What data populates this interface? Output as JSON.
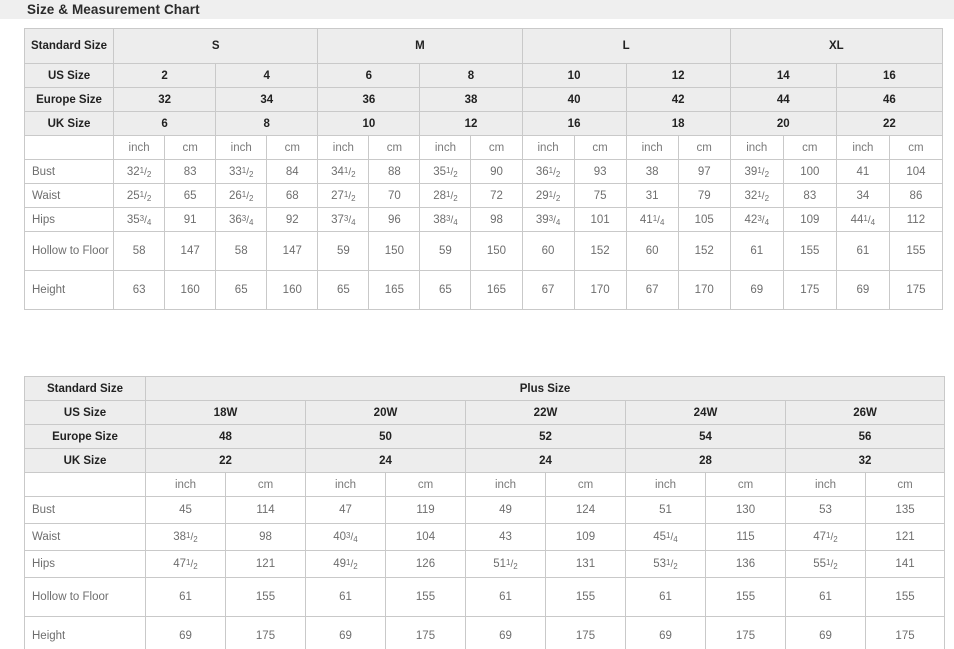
{
  "page": {
    "title": "Size & Measurement Chart",
    "title_band_color": "#efefef",
    "header_cell_color": "#ededed",
    "border_color": "#c9c9c9",
    "text_color": "#6e6e6e",
    "header_text_color": "#222222"
  },
  "table1": {
    "label_standard_size": "Standard Size",
    "label_us_size": "US Size",
    "label_europe_size": "Europe Size",
    "label_uk_size": "UK Size",
    "unit_inch": "inch",
    "unit_cm": "cm",
    "size_groups": [
      {
        "name": "S",
        "span": 4
      },
      {
        "name": "M",
        "span": 4
      },
      {
        "name": "L",
        "span": 4
      },
      {
        "name": "XL",
        "span": 4
      }
    ],
    "us_sizes": [
      "2",
      "4",
      "6",
      "8",
      "10",
      "12",
      "14",
      "16"
    ],
    "europe_sizes": [
      "32",
      "34",
      "36",
      "38",
      "40",
      "42",
      "44",
      "46"
    ],
    "uk_sizes": [
      "6",
      "8",
      "10",
      "12",
      "16",
      "18",
      "20",
      "22"
    ],
    "rows": [
      {
        "label": "Bust",
        "inch": [
          "32 1/2",
          "33 1/2",
          "34 1/2",
          "35 1/2",
          "36 1/2",
          "38",
          "39 1/2",
          "41"
        ],
        "cm": [
          "83",
          "84",
          "88",
          "90",
          "93",
          "97",
          "100",
          "104"
        ]
      },
      {
        "label": "Waist",
        "inch": [
          "25 1/2",
          "26 1/2",
          "27 1/2",
          "28 1/2",
          "29 1/2",
          "31",
          "32 1/2",
          "34"
        ],
        "cm": [
          "65",
          "68",
          "70",
          "72",
          "75",
          "79",
          "83",
          "86"
        ]
      },
      {
        "label": "Hips",
        "inch": [
          "35 3/4",
          "36 3/4",
          "37 3/4",
          "38 3/4",
          "39 3/4",
          "41 1/4",
          "42 3/4",
          "44 1/4"
        ],
        "cm": [
          "91",
          "92",
          "96",
          "98",
          "101",
          "105",
          "109",
          "112"
        ]
      },
      {
        "label": "Hollow to Floor",
        "inch": [
          "58",
          "58",
          "59",
          "59",
          "60",
          "60",
          "61",
          "61"
        ],
        "cm": [
          "147",
          "147",
          "150",
          "150",
          "152",
          "152",
          "155",
          "155"
        ]
      },
      {
        "label": "Height",
        "inch": [
          "63",
          "65",
          "65",
          "65",
          "67",
          "67",
          "69",
          "69"
        ],
        "cm": [
          "160",
          "160",
          "165",
          "165",
          "170",
          "170",
          "175",
          "175"
        ]
      }
    ]
  },
  "table2": {
    "label_standard_size": "Standard Size",
    "label_plus_size": "Plus Size",
    "label_us_size": "US Size",
    "label_europe_size": "Europe Size",
    "label_uk_size": "UK Size",
    "unit_inch": "inch",
    "unit_cm": "cm",
    "us_sizes": [
      "18W",
      "20W",
      "22W",
      "24W",
      "26W"
    ],
    "europe_sizes": [
      "48",
      "50",
      "52",
      "54",
      "56"
    ],
    "uk_sizes": [
      "22",
      "24",
      "24",
      "28",
      "32"
    ],
    "rows": [
      {
        "label": "Bust",
        "inch": [
          "45",
          "47",
          "49",
          "51",
          "53"
        ],
        "cm": [
          "114",
          "119",
          "124",
          "130",
          "135"
        ]
      },
      {
        "label": "Waist",
        "inch": [
          "38 1/2",
          "40 3/4",
          "43",
          "45 1/4",
          "47 1/2"
        ],
        "cm": [
          "98",
          "104",
          "109",
          "115",
          "121"
        ]
      },
      {
        "label": "Hips",
        "inch": [
          "47 1/2",
          "49 1/2",
          "51 1/2",
          "53 1/2",
          "55 1/2"
        ],
        "cm": [
          "121",
          "126",
          "131",
          "136",
          "141"
        ]
      },
      {
        "label": "Hollow to Floor",
        "inch": [
          "61",
          "61",
          "61",
          "61",
          "61"
        ],
        "cm": [
          "155",
          "155",
          "155",
          "155",
          "155"
        ]
      },
      {
        "label": "Height",
        "inch": [
          "69",
          "69",
          "69",
          "69",
          "69"
        ],
        "cm": [
          "175",
          "175",
          "175",
          "175",
          "175"
        ]
      }
    ]
  }
}
